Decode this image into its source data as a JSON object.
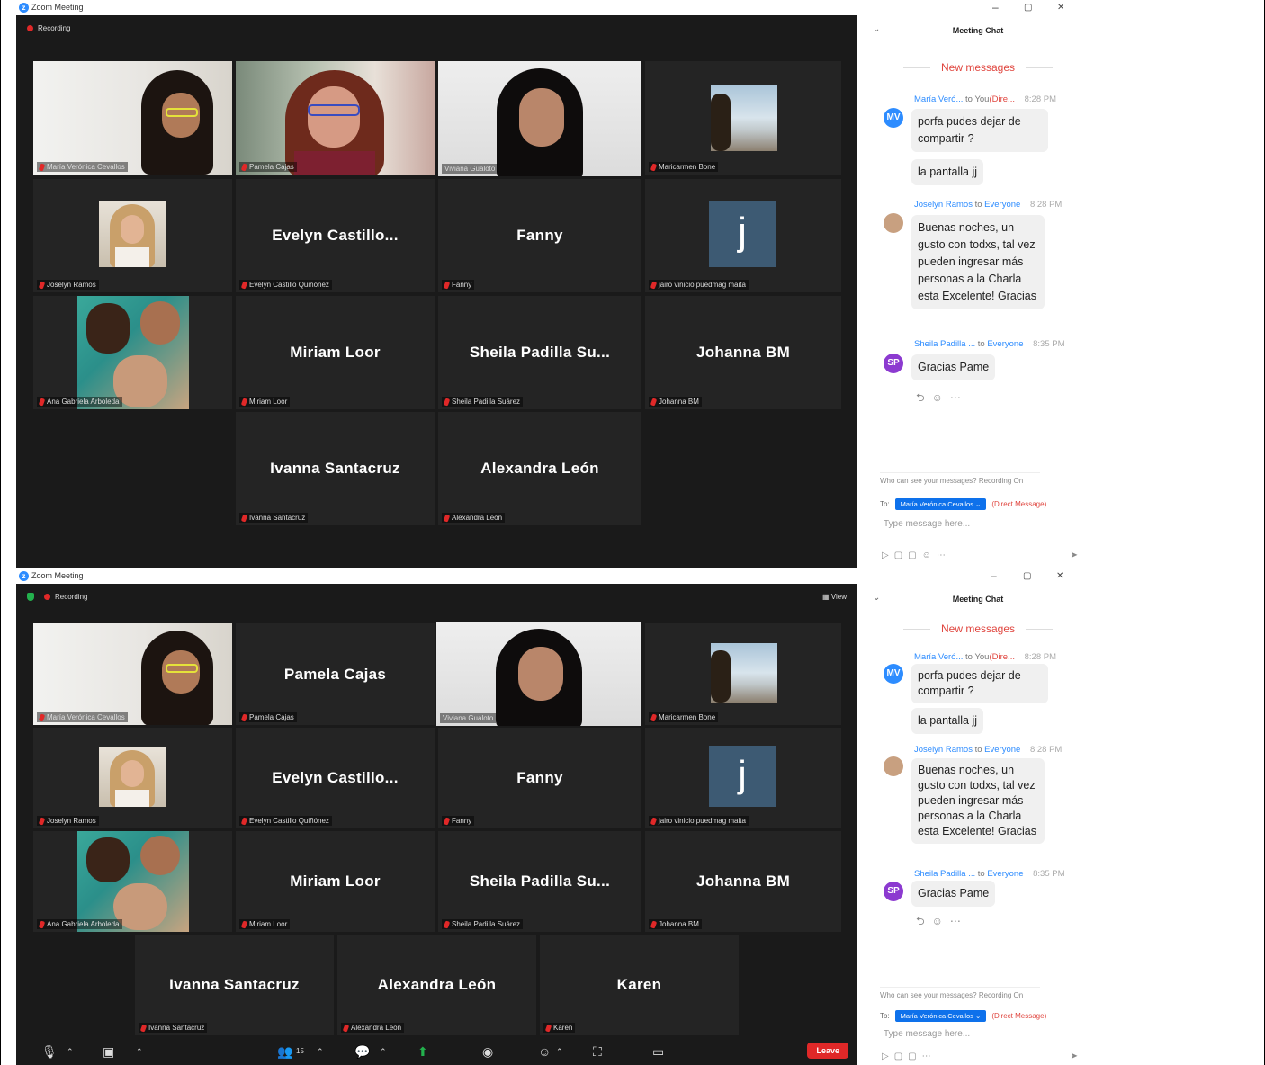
{
  "window": {
    "app_title": "Zoom Meeting",
    "recording_label": "Recording",
    "view_label": "View",
    "minimize": "–",
    "restore": "▢",
    "close": "✕"
  },
  "top": {
    "tiles": [
      {
        "caption": "María Verónica Cevallos"
      },
      {
        "caption": "Pamela Cajas"
      },
      {
        "caption": "Viviana Gualoto"
      },
      {
        "caption": "Maricarmen Bone"
      },
      {
        "caption": "Joselyn Ramos"
      },
      {
        "name": "Evelyn  Castillo...",
        "caption": "Evelyn Castillo Quiñónez"
      },
      {
        "name": "Fanny",
        "caption": "Fanny"
      },
      {
        "name": "j",
        "caption": "jairo vinicio puedmag maita"
      },
      {
        "caption": "Ana Gabriela Arboleda"
      },
      {
        "name": "Miriam Loor",
        "caption": "Miriam Loor"
      },
      {
        "name": "Sheila Padilla Su...",
        "caption": "Sheila Padilla Suárez"
      },
      {
        "name": "Johanna BM",
        "caption": "Johanna BM"
      },
      {
        "name": "Ivanna Santacruz",
        "caption": "Ivanna Santacruz"
      },
      {
        "name": "Alexandra León",
        "caption": "Alexandra León"
      }
    ]
  },
  "bottom": {
    "tiles": [
      {
        "caption": "María Verónica Cevallos"
      },
      {
        "name": "Pamela Cajas",
        "caption": "Pamela Cajas"
      },
      {
        "caption": "Viviana Gualoto"
      },
      {
        "caption": "Maricarmen Bone"
      },
      {
        "caption": "Joselyn Ramos"
      },
      {
        "name": "Evelyn  Castillo...",
        "caption": "Evelyn Castillo Quiñónez"
      },
      {
        "name": "Fanny",
        "caption": "Fanny"
      },
      {
        "name": "j",
        "caption": "jairo vinicio puedmag maita"
      },
      {
        "caption": "Ana Gabriela Arboleda"
      },
      {
        "name": "Miriam Loor",
        "caption": "Miriam Loor"
      },
      {
        "name": "Sheila Padilla Su...",
        "caption": "Sheila Padilla Suárez"
      },
      {
        "name": "Johanna BM",
        "caption": "Johanna BM"
      },
      {
        "name": "Ivanna Santacruz",
        "caption": "Ivanna Santacruz"
      },
      {
        "name": "Alexandra León",
        "caption": "Alexandra León"
      },
      {
        "name": "Karen",
        "caption": "Karen"
      }
    ],
    "toolbar": {
      "participants_count": "15",
      "leave_label": "Leave"
    }
  },
  "chat": {
    "title": "Meeting Chat",
    "new_messages": "New messages",
    "messages": [
      {
        "sender": "María Veró...",
        "to_label": "to",
        "recipient": "You",
        "dm": "(Dire...",
        "time": "8:28 PM",
        "initials": "MV",
        "lines": [
          "porfa pudes dejar de compartir ?",
          "la pantalla jj"
        ]
      },
      {
        "sender": "Joselyn Ramos",
        "to_label": "to",
        "recipient": "Everyone",
        "time": "8:28 PM",
        "text": "Buenas noches, un gusto con todxs, tal vez pueden ingresar más personas a la Charla esta Excelente! Gracias"
      },
      {
        "sender": "Sheila Padilla ...",
        "to_label": "to",
        "recipient": "Everyone",
        "time": "8:35 PM",
        "initials": "SP",
        "text": "Gracias Pame"
      }
    ],
    "who_can_see": "Who can see your messages? Recording On",
    "to_prefix": "To:",
    "to_selected": "María Verónica Cevallos ⌄",
    "direct_message": "(Direct Message)",
    "placeholder": "Type message here..."
  },
  "colors": {
    "stage": "#1a1a1a",
    "tile": "#242424",
    "active_speaker": "#c8e65a",
    "accent": "#2d8cff",
    "alert": "#e0463f",
    "initial_tile": "#3d5a73"
  }
}
